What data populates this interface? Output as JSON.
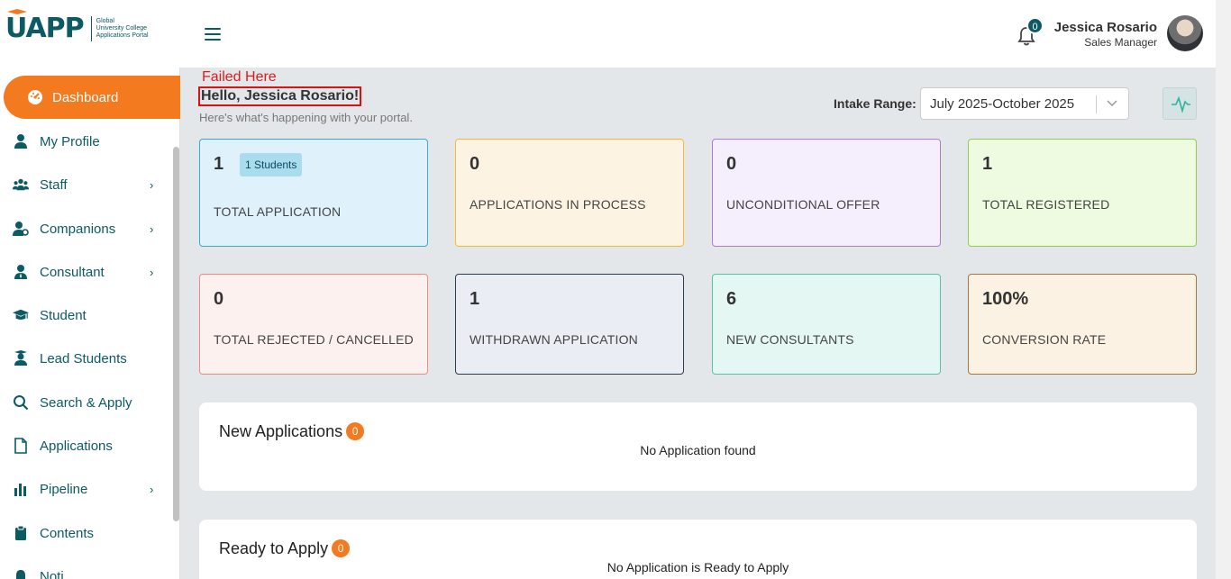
{
  "header": {
    "logo_text": "UAPP",
    "logo_sub": [
      "Global",
      "University College",
      "Applications Portal"
    ],
    "notification_count": "0",
    "user_name": "Jessica Rosario",
    "user_role": "Sales Manager"
  },
  "sidebar": {
    "items": [
      {
        "label": "Dashboard",
        "icon": "dashboard-icon",
        "active": true,
        "has_submenu": false
      },
      {
        "label": "My Profile",
        "icon": "user-icon",
        "active": false,
        "has_submenu": false
      },
      {
        "label": "Staff",
        "icon": "users-icon",
        "active": false,
        "has_submenu": true
      },
      {
        "label": "Companions",
        "icon": "companions-icon",
        "active": false,
        "has_submenu": true
      },
      {
        "label": "Consultant",
        "icon": "consultant-icon",
        "active": false,
        "has_submenu": true
      },
      {
        "label": "Student",
        "icon": "graduation-cap-icon",
        "active": false,
        "has_submenu": false
      },
      {
        "label": "Lead Students",
        "icon": "lead-student-icon",
        "active": false,
        "has_submenu": false
      },
      {
        "label": "Search & Apply",
        "icon": "search-icon",
        "active": false,
        "has_submenu": false
      },
      {
        "label": "Applications",
        "icon": "document-icon",
        "active": false,
        "has_submenu": false
      },
      {
        "label": "Pipeline",
        "icon": "bar-chart-icon",
        "active": false,
        "has_submenu": true
      },
      {
        "label": "Contents",
        "icon": "clipboard-icon",
        "active": false,
        "has_submenu": false
      },
      {
        "label": "Noti",
        "icon": "notification-icon",
        "active": false,
        "has_submenu": false
      }
    ]
  },
  "main": {
    "error_annotation": "Failed Here",
    "greeting": "Hello, Jessica Rosario!",
    "subtitle": "Here's what's happening with your portal.",
    "intake_label": "Intake Range:",
    "intake_value": "July 2025-October 2025",
    "stats": [
      {
        "value": "1",
        "label": "TOTAL APPLICATION",
        "chip": "1 Students",
        "bg": "#dff2fb",
        "border": "#3aa8d3"
      },
      {
        "value": "0",
        "label": "APPLICATIONS IN PROCESS",
        "bg": "#fdf3e3",
        "border": "#f5b83d"
      },
      {
        "value": "0",
        "label": "UNCONDITIONAL OFFER",
        "bg": "#f5eefc",
        "border": "#b07ae0"
      },
      {
        "value": "1",
        "label": "TOTAL REGISTERED",
        "bg": "#eefbe0",
        "border": "#8ed14b"
      },
      {
        "value": "0",
        "label": "TOTAL REJECTED / CANCELLED",
        "bg": "#fdf1ef",
        "border": "#ec8a80"
      },
      {
        "value": "1",
        "label": "WITHDRAWN APPLICATION",
        "bg": "#eaedf3",
        "border": "#2c3a52"
      },
      {
        "value": "6",
        "label": "NEW CONSULTANTS",
        "bg": "#e5f7f2",
        "border": "#57c2a6"
      },
      {
        "value": "100%",
        "label": "CONVERSION RATE",
        "bg": "#fcf2e3",
        "border": "#a8773b"
      }
    ],
    "new_applications": {
      "title": "New Applications",
      "count": "0",
      "empty": "No Application found"
    },
    "ready_to_apply": {
      "title": "Ready to Apply",
      "count": "0",
      "empty": "No Application is Ready to Apply"
    }
  }
}
